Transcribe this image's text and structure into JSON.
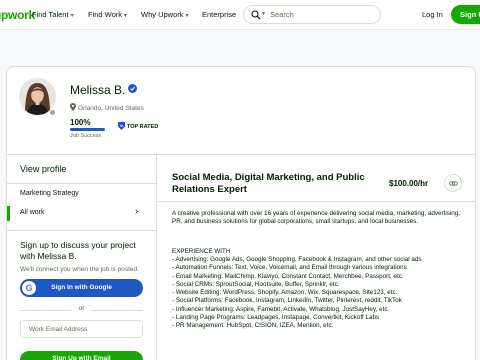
{
  "nav": {
    "logo": "upwork",
    "items": [
      "Find Talent",
      "Find Work",
      "Why Upwork",
      "Enterprise"
    ],
    "search_placeholder": "Search",
    "login": "Log In",
    "signup": "Sign Up"
  },
  "profile": {
    "name": "Melissa B.",
    "location": "Orlando, United States",
    "job_success_value": "100%",
    "job_success_fraction": 1.0,
    "job_success_label": "Job Success",
    "badge": "TOP RATED"
  },
  "sidebar": {
    "view_profile": "View profile",
    "items": [
      {
        "label": "Marketing Strategy"
      },
      {
        "label": "All work"
      }
    ]
  },
  "cta": {
    "title": "Sign up to discuss your project with Melissa B.",
    "subtitle": "We'll connect you when the job is posted.",
    "google_button": "Sign In with Google",
    "or": "or",
    "email_placeholder": "Work Email Address",
    "email_button": "Sign Up with Email"
  },
  "job": {
    "title": "Social Media, Digital Marketing, and Public Relations Expert",
    "rate": "$100.00/hr",
    "description": "A creative professional with over 16 years of experience delivering social media, marketing, advertising, PR, and business solutions for global corporations, small startups, and local businesses.",
    "experience_title": "EXPERIENCE WITH",
    "experience": [
      "- Advertising: Google Ads, Google Shopping, Facebook & Instagram, and other social ads",
      "- Automation Funnels: Text, Voice, Voicemail, and Email through various integrations",
      "- Email Marketing: MailChimp, Klaviyo, Constant Contact, Merchbee, Passport, etc.",
      "- Social CRMs: SproutSocial, Hootsuite, Buffer, Sprinklr, etc.",
      "- Website Editing: WordPress, Shopify, Amazon, Wix, Squarespace, Site123, etc.",
      "- Social Platforms: Facebook, Instagram, LinkedIn, Twitter, Pinterest, reddit, TikTok",
      "- Influencer Marketing: Aspire, Famebit, Activate, Whatsblog, JustSayHey, etc.",
      "- Landing Page Programs: Leadpages, Instapage, Convertkit, Kickoff Labs",
      "- PR Management: HubSpot, CISION, IZEA, Mention, etc."
    ]
  },
  "colors": {
    "brand_green": "#14a800",
    "google_blue": "#1f57c3",
    "text": "#001e00",
    "muted": "#5e6d55"
  }
}
